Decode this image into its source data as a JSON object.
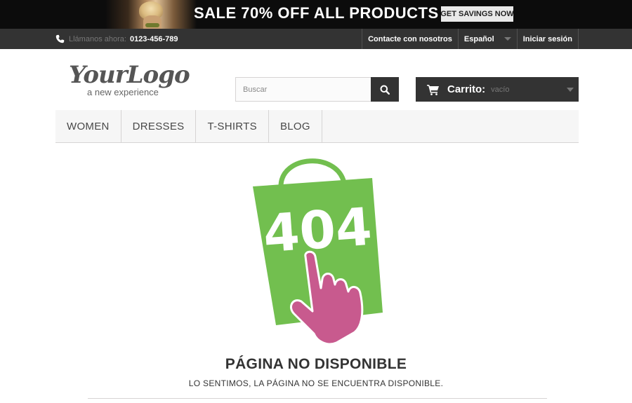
{
  "banner": {
    "text": "SALE 70% OFF ALL PRODUCTS",
    "cta_label": "GET SAVINGS NOW"
  },
  "topbar": {
    "phone_icon": "phone-icon",
    "call_label": "Llámanos ahora:",
    "phone_number": "0123-456-789",
    "contact_label": "Contacte con nosotros",
    "language_label": "Español",
    "login_label": "Iniciar sesión"
  },
  "header": {
    "logo_text": "YourLogo",
    "logo_tagline": "a new experience",
    "search_placeholder": "Buscar",
    "search_icon": "search-icon",
    "cart_icon": "cart-icon",
    "cart_label": "Carrito:",
    "cart_status": "vacío"
  },
  "menu": {
    "items": [
      {
        "label": "WOMEN"
      },
      {
        "label": "DRESSES"
      },
      {
        "label": "T-SHIRTS"
      },
      {
        "label": "BLOG"
      }
    ]
  },
  "error": {
    "code": "404",
    "title": "PÁGINA NO DISPONIBLE",
    "subtitle": "LO SENTIMOS, LA PÁGINA NO SE ENCUENTRA DISPONIBLE."
  },
  "colors": {
    "bag_green": "#72bf4f",
    "hand_pink": "#c85a8e",
    "dark_bar": "#333333"
  }
}
